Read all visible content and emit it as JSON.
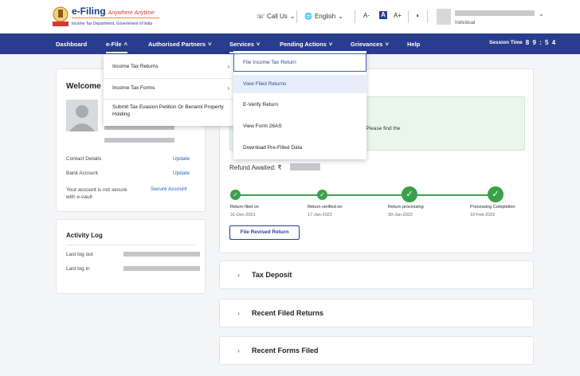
{
  "brand": {
    "title": "e-Filing",
    "tagline": "Anywhere Anytime",
    "subtitle": "Income Tax Department, Government of India"
  },
  "header": {
    "call_us": "Call Us",
    "language": "English",
    "font_smaller": "A-",
    "font_default": "A",
    "font_larger": "A+",
    "user_role": "Individual"
  },
  "nav": {
    "items": [
      {
        "label": "Dashboard"
      },
      {
        "label": "e-File"
      },
      {
        "label": "Authorised Partners"
      },
      {
        "label": "Services"
      },
      {
        "label": "Pending Actions"
      },
      {
        "label": "Grievances"
      },
      {
        "label": "Help"
      }
    ],
    "session_label": "Session Time",
    "session_value": "8 9 : 5 4"
  },
  "efile_menu": {
    "items": [
      {
        "label": "Income Tax Returns"
      },
      {
        "label": "Income Tax Forms"
      },
      {
        "label": "Submit Tax Evasion Petition Or Benami Property Holding"
      }
    ]
  },
  "services_menu": {
    "items": [
      {
        "label": "File Income Tax Return"
      },
      {
        "label": "View Filed Returns"
      },
      {
        "label": "E-Verify Return"
      },
      {
        "label": "View Form 26AS"
      },
      {
        "label": "Download Pre-Filled Data"
      }
    ]
  },
  "welcome": {
    "title": "Welcome",
    "contact_label": "Contact Details",
    "contact_link": "Update",
    "bank_label": "Bank Account",
    "bank_link": "Update",
    "security_label": "Your account is not secure with e-vault",
    "security_link": "Secure Account"
  },
  "activity": {
    "title": "Activity Log",
    "last_out": "Last log out",
    "last_in": "Last log in"
  },
  "status": {
    "notice": "sure it is completed at the earliest. Please find the",
    "refund_label": "Refund Awaited: ₹",
    "steps": [
      {
        "label": "Return filed on",
        "date": "31-Dec-2021"
      },
      {
        "label": "Return verified on",
        "date": "17-Jan-2022"
      },
      {
        "label": "Return processing",
        "date": "30-Jan-2022"
      },
      {
        "label": "Processing Completion",
        "date": "10-Feb-2022"
      }
    ],
    "revised_button": "File Revised Return"
  },
  "accordions": [
    {
      "title": "Tax Deposit"
    },
    {
      "title": "Recent Filed Returns"
    },
    {
      "title": "Recent Forms Filed"
    }
  ],
  "colors": {
    "primary": "#2a3c8e",
    "success": "#3aa14a",
    "link": "#2a5db0"
  }
}
